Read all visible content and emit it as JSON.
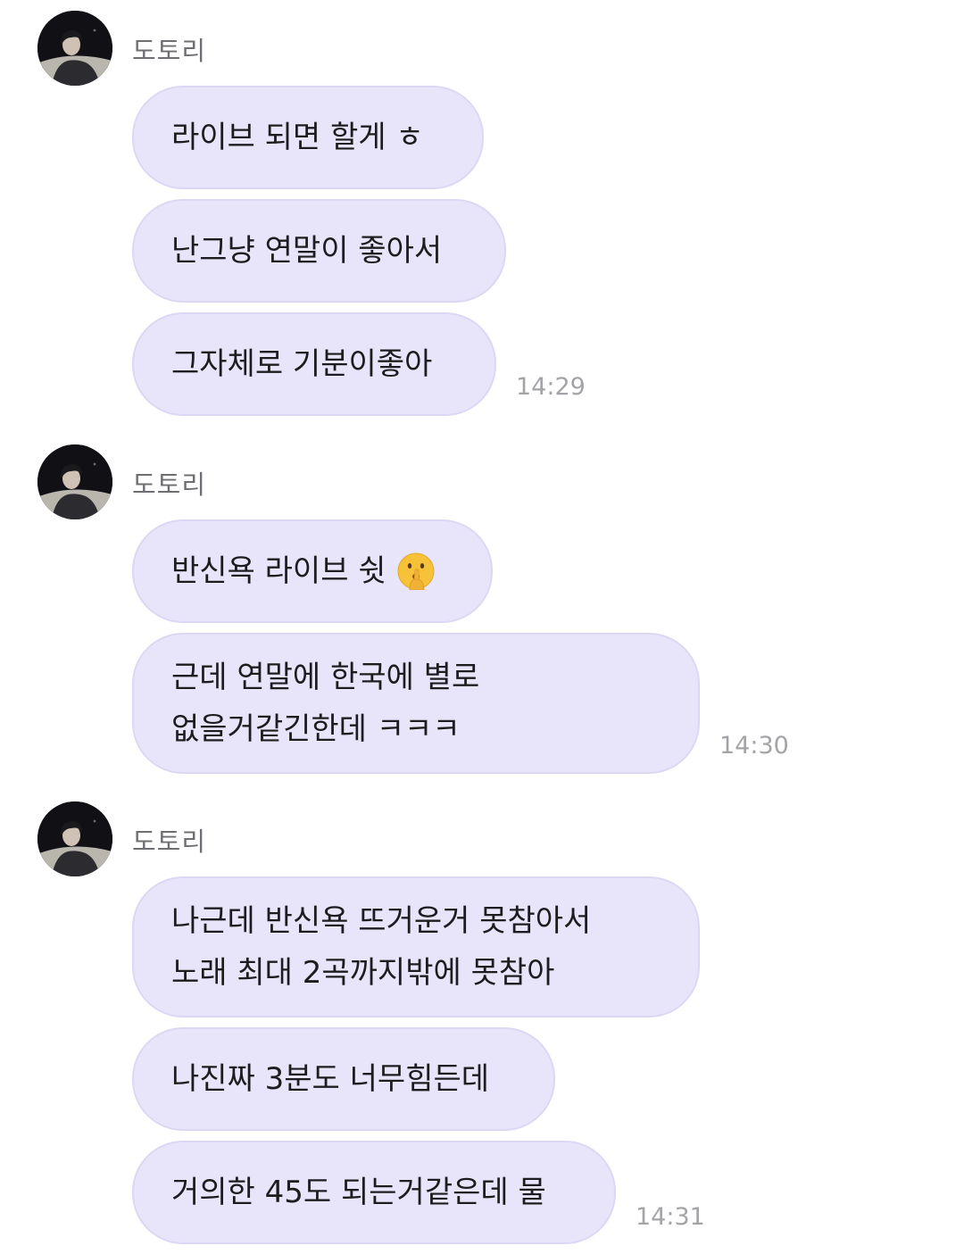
{
  "groups": [
    {
      "sender": "도토리",
      "messages": [
        "라이브 되면 할게 ㅎ",
        "난그냥 연말이 좋아서",
        "그자체로 기분이좋아"
      ],
      "time": "14:29"
    },
    {
      "sender": "도토리",
      "messages": [
        "반신욕 라이브 쉿",
        "근데 연말에 한국에 별로\n없을거같긴한데 ㅋㅋㅋ"
      ],
      "emoji": "shushing-face-emoji",
      "time": "14:30"
    },
    {
      "sender": "도토리",
      "messages": [
        "나근데 반신욕 뜨거운거 못참아서\n노래 최대 2곡까지밖에 못참아",
        "나진짜 3분도 너무힘든데",
        "거의한 45도 되는거같은데 물"
      ],
      "time": "14:31"
    }
  ],
  "colors": {
    "bubble": "#e8e5fa",
    "bubble_border": "#dcd8f3",
    "sender_text": "#6f6f73",
    "time_text": "#a4a4a8",
    "message_text": "#1d1d1f"
  },
  "avatar_icon": "profile-photo-avatar"
}
